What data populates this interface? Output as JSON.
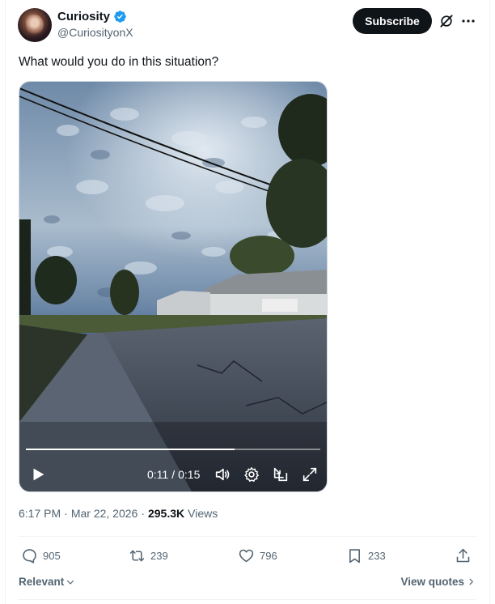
{
  "author": {
    "display_name": "Curiosity",
    "handle": "@CuriosityonX",
    "verified": true
  },
  "header": {
    "subscribe_label": "Subscribe",
    "grok_icon": "grok-icon",
    "more_icon": "more-icon"
  },
  "tweet": {
    "text": "What would you do in this situation?"
  },
  "video": {
    "current_time": "0:11",
    "separator": "/",
    "duration": "0:15",
    "progress_fraction": 0.71,
    "controls": [
      "play-icon",
      "volume-icon",
      "settings-icon",
      "pip-icon",
      "fullscreen-icon"
    ]
  },
  "meta": {
    "time": "6:17 PM",
    "dot1": "·",
    "date": "Mar 22, 2026",
    "dot2": "·",
    "views_count": "295.3K",
    "views_label": "Views"
  },
  "actions": {
    "replies": "905",
    "reposts": "239",
    "likes": "796",
    "bookmarks": "233"
  },
  "footer": {
    "sort_label": "Relevant",
    "view_quotes_label": "View quotes"
  },
  "colors": {
    "text": "#0f1419",
    "secondary": "#536471",
    "verified_blue": "#1d9bf0",
    "border": "#eff3f4"
  }
}
